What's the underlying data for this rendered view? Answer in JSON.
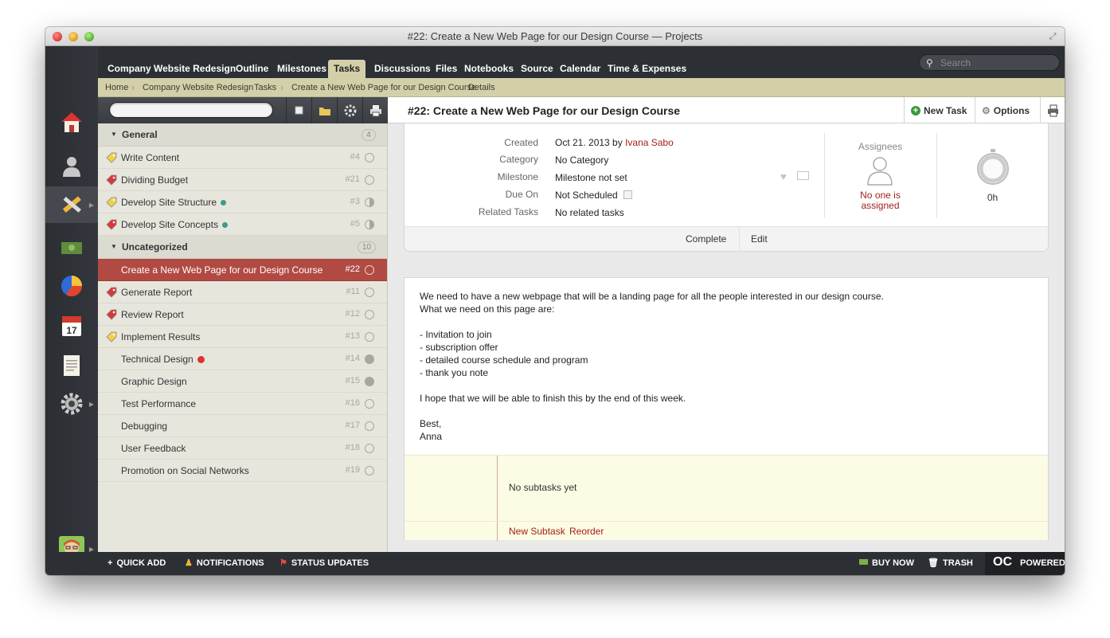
{
  "window": {
    "title": "#22: Create a New Web Page for our Design Course — Projects"
  },
  "nav": {
    "project": "Company Website Redesign",
    "tabs": [
      "Outline",
      "Milestones",
      "Tasks",
      "Discussions",
      "Files",
      "Notebooks",
      "Source",
      "Calendar",
      "Time & Expenses"
    ],
    "active_tab": "Tasks",
    "search_placeholder": "Search"
  },
  "breadcrumb": [
    "Home",
    "Company Website Redesign",
    "Tasks",
    "Create a New Web Page for our Design Course",
    "Details"
  ],
  "list": {
    "groups": [
      {
        "title": "General",
        "count": "4",
        "tasks": [
          {
            "label": "Write Content",
            "num": "#4",
            "tag": "yellow",
            "status": "empty"
          },
          {
            "label": "Dividing Budget",
            "num": "#21",
            "tag": "red",
            "status": "empty"
          },
          {
            "label": "Develop Site Structure",
            "num": "#3",
            "tag": "yellow",
            "status": "half",
            "dot": "#3a9a8f"
          },
          {
            "label": "Develop Site Concepts",
            "num": "#5",
            "tag": "red",
            "status": "half",
            "dot": "#3a9a8f"
          }
        ]
      },
      {
        "title": "Uncategorized",
        "count": "10",
        "tasks": [
          {
            "label": "Create a New Web Page for our Design Course",
            "num": "#22",
            "tag": "",
            "status": "empty",
            "selected": true
          },
          {
            "label": "Generate Report",
            "num": "#11",
            "tag": "red",
            "status": "empty"
          },
          {
            "label": "Review Report",
            "num": "#12",
            "tag": "red",
            "status": "empty"
          },
          {
            "label": "Implement Results",
            "num": "#13",
            "tag": "yellow",
            "status": "empty"
          },
          {
            "label": "Technical Design",
            "num": "#14",
            "tag": "",
            "status": "full",
            "blocked": true
          },
          {
            "label": "Graphic Design",
            "num": "#15",
            "tag": "",
            "status": "full"
          },
          {
            "label": "Test Performance",
            "num": "#16",
            "tag": "",
            "status": "empty"
          },
          {
            "label": "Debugging",
            "num": "#17",
            "tag": "",
            "status": "empty"
          },
          {
            "label": "User Feedback",
            "num": "#18",
            "tag": "",
            "status": "empty"
          },
          {
            "label": "Promotion on Social Networks",
            "num": "#19",
            "tag": "",
            "status": "empty"
          }
        ]
      }
    ]
  },
  "detail": {
    "title": "#22: Create a New Web Page for our Design Course",
    "new_task": "New Task",
    "options": "Options",
    "fields": {
      "created_label": "Created",
      "created_value": "Oct 21. 2013 by ",
      "created_by": "Ivana Sabo",
      "category_label": "Category",
      "category_value": "No Category",
      "milestone_label": "Milestone",
      "milestone_value": "Milestone not set",
      "due_label": "Due On",
      "due_value": "Not Scheduled",
      "related_label": "Related Tasks",
      "related_value": "No related tasks"
    },
    "assignees_label": "Assignees",
    "assignees_value": "No one is assigned",
    "time_value": "0h",
    "complete": "Complete",
    "edit": "Edit",
    "body_lines": [
      "We need to have a new webpage that will be a landing page for all the people interested in our design course.",
      "What we need on this page are:",
      "",
      "- Invitation to join",
      "- subscription offer",
      "- detailed course schedule and program",
      "- thank you note",
      "",
      "I hope that we will be able to finish this by the end of this week.",
      "",
      "Best,",
      "Anna"
    ],
    "subtasks_empty": "No subtasks yet",
    "new_subtask": "New Subtask",
    "reorder": "Reorder"
  },
  "bottom": {
    "quick_add": "QUICK ADD",
    "notifications": "NOTIFICATIONS",
    "status_updates": "STATUS UPDATES",
    "buy_now": "BUY NOW",
    "trash": "TRASH",
    "powered": "POWERED"
  },
  "colors": {
    "accent": "#b24a44",
    "breadcrumb_bg": "#d3d0a9",
    "dark_bar": "#2c2f34",
    "link": "#a3221b"
  }
}
